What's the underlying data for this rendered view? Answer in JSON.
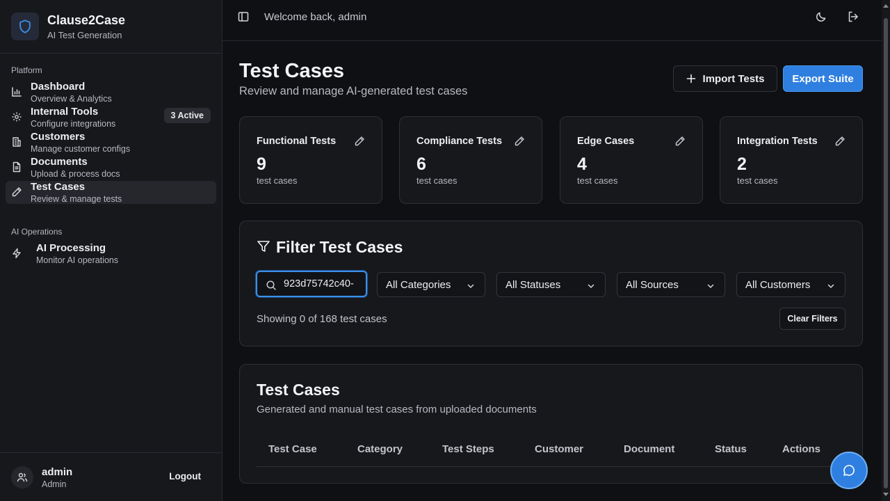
{
  "brand": {
    "title": "Clause2Case",
    "subtitle": "AI Test Generation"
  },
  "sidebar": {
    "sections": [
      {
        "label": "Platform"
      },
      {
        "label": "AI Operations"
      }
    ],
    "items": [
      {
        "title": "Dashboard",
        "desc": "Overview & Analytics",
        "icon": "bar-chart-icon"
      },
      {
        "title": "Internal Tools",
        "desc": "Configure integrations",
        "icon": "gear-icon",
        "badge": "3 Active"
      },
      {
        "title": "Customers",
        "desc": "Manage customer configs",
        "icon": "building-icon"
      },
      {
        "title": "Documents",
        "desc": "Upload & process docs",
        "icon": "document-icon"
      },
      {
        "title": "Test Cases",
        "desc": "Review & manage tests",
        "icon": "pencil-icon",
        "active": true
      },
      {
        "title": "AI Processing",
        "desc": "Monitor AI operations",
        "icon": "lightning-icon"
      }
    ],
    "user": {
      "name": "admin",
      "role": "Admin",
      "logout": "Logout"
    }
  },
  "topbar": {
    "welcome": "Welcome back, admin"
  },
  "page": {
    "title": "Test Cases",
    "subtitle": "Review and manage AI-generated test cases",
    "import_label": "Import Tests",
    "export_label": "Export Suite"
  },
  "stats": [
    {
      "title": "Functional Tests",
      "value": "9",
      "unit": "test cases"
    },
    {
      "title": "Compliance Tests",
      "value": "6",
      "unit": "test cases"
    },
    {
      "title": "Edge Cases",
      "value": "4",
      "unit": "test cases"
    },
    {
      "title": "Integration Tests",
      "value": "2",
      "unit": "test cases"
    }
  ],
  "filter": {
    "title": "Filter Test Cases",
    "search_value": "-923d75742c40",
    "selects": [
      "All Categories",
      "All Statuses",
      "All Sources",
      "All Customers"
    ],
    "showing": "Showing 0 of 168 test cases",
    "clear_label": "Clear Filters"
  },
  "table": {
    "title": "Test Cases",
    "subtitle": "Generated and manual test cases from uploaded documents",
    "columns": [
      "Test Case",
      "Category",
      "Test Steps",
      "Customer",
      "Document",
      "Status",
      "Actions"
    ]
  },
  "colors": {
    "accent": "#2f7fe0",
    "background": "#0f1014",
    "card": "#17181c"
  }
}
